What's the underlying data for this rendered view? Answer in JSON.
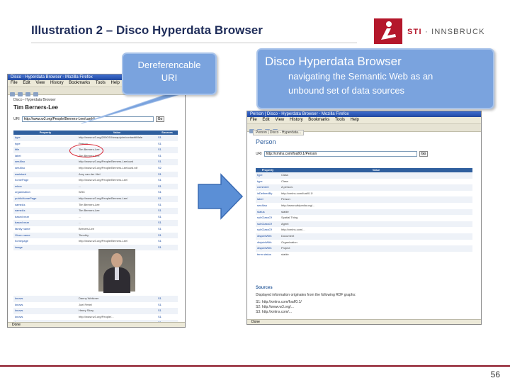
{
  "slide": {
    "title": "Illustration 2 – Disco Hyperdata Browser",
    "page_number": "56"
  },
  "logo": {
    "text_sti": "STI",
    "text_rest": " · INNSBRUCK"
  },
  "callouts": {
    "left": {
      "line1": "Dereferencable",
      "line2": "URI"
    },
    "right": {
      "title": "Disco Hyperdata Browser",
      "line1": "navigating the Semantic Web as an",
      "line2": "unbound set of data sources"
    }
  },
  "arrow": {
    "icon": "right-arrow-icon",
    "color": "#5b8fd6"
  },
  "left_browser": {
    "window_title": "Disco - Hyperdata Browser - Mozilla Firefox",
    "menu": [
      "File",
      "Edit",
      "View",
      "History",
      "Bookmarks",
      "Tools",
      "Help"
    ],
    "header": "Disco - Hyperdata Browser",
    "person": "Tim Berners-Lee",
    "uri_label": "URI",
    "uri_value": "http://www.w3.org/People/Berners-Lee/card#i",
    "go_button": "Go",
    "columns": [
      "Property",
      "Value",
      "Sources"
    ],
    "rows": [
      [
        "type",
        "http://www.w3.org/2000/10/swap/pim/contact#Male",
        "S1"
      ],
      [
        "type",
        "Person",
        "S1"
      ],
      [
        "title",
        "Tim Berners-Lee",
        "S1"
      ],
      [
        "label",
        "Tim Berners-Lee",
        "S1"
      ],
      [
        "seeAlso",
        "http://www.w3.org/People/Berners-Lee/card",
        "S1"
      ],
      [
        "seeAlso",
        "http://www.w3.org/People/Berners-Lee/card.rdf",
        "S2"
      ],
      [
        "assistant",
        "Amy van der Hiel",
        "S1"
      ],
      [
        "homePage",
        "http://www.w3.org/People/Berners-Lee/",
        "S1"
      ],
      [
        "mbox",
        "...",
        "S1"
      ],
      [
        "organization",
        "W3C",
        "S1"
      ],
      [
        "publicHomePage",
        "http://www.w3.org/People/Berners-Lee/",
        "S1"
      ],
      [
        "sameAs",
        "Tim Berners-Lee",
        "S1"
      ],
      [
        "sameAs",
        "Tim Berners-Lee",
        "S1"
      ],
      [
        "based near",
        "...",
        "S1"
      ],
      [
        "based near",
        "...",
        "S1"
      ],
      [
        "family name",
        "Berners-Lee",
        "S1"
      ],
      [
        "Given name",
        "Timothy",
        "S1"
      ],
      [
        "homepage",
        "http://www.w3.org/People/Berners-Lee/",
        "S1"
      ],
      [
        "image",
        "",
        "S1"
      ]
    ],
    "lower_rows": [
      [
        "knows",
        "Danny Weitzner",
        "S1"
      ],
      [
        "knows",
        "Joel Fertel",
        "S1"
      ],
      [
        "knows",
        "Henry Story",
        "S1"
      ],
      [
        "knows",
        "http://www.w3.org/People/...",
        "S1"
      ],
      [
        "knows",
        "...",
        "S1"
      ],
      [
        "knows",
        "Ira Fuchs",
        "S1"
      ]
    ],
    "status": "Done"
  },
  "right_browser": {
    "window_title": "Person | Disco - Hyperdata Browser - Mozilla Firefox",
    "menu": [
      "File",
      "Edit",
      "View",
      "History",
      "Bookmarks",
      "Tools",
      "Help"
    ],
    "tab": "Person | Disco - Hyperdata...",
    "heading": "Person",
    "uri_label": "URI",
    "uri_value": "http://xmlns.com/foaf/0.1/Person",
    "go_button": "Go",
    "columns": [
      "Property",
      "Value"
    ],
    "rows": [
      [
        "type",
        "Class"
      ],
      [
        "type",
        "Class"
      ],
      [
        "comment",
        "A person."
      ],
      [
        "isDefinedBy",
        "http://xmlns.com/foaf/0.1/"
      ],
      [
        "label",
        "Person"
      ],
      [
        "seeAlso",
        "http://www.wikipedia.org/..."
      ],
      [
        "status",
        "stable"
      ],
      [
        "subClassOf",
        "Spatial Thing"
      ],
      [
        "subClassOf",
        "Agent"
      ],
      [
        "subClassOf",
        "http://xmlns.com/..."
      ],
      [
        "disjointWith",
        "Document"
      ],
      [
        "disjointWith",
        "Organization"
      ],
      [
        "disjointWith",
        "Project"
      ],
      [
        "term status",
        "stable"
      ]
    ],
    "sources_title": "Sources",
    "sources_intro": "Displayed information originates from the following RDF graphs:",
    "sources": [
      "S1: http://xmlns.com/foaf/0.1/",
      "S2: http://www.w3.org/...",
      "S3: http://xmlns.com/..."
    ],
    "status": "Done"
  },
  "colors": {
    "title": "#1f2d5a",
    "callout": "#7aa3de",
    "accent_red": "#b4172b",
    "table_header": "#2f5f9e"
  }
}
